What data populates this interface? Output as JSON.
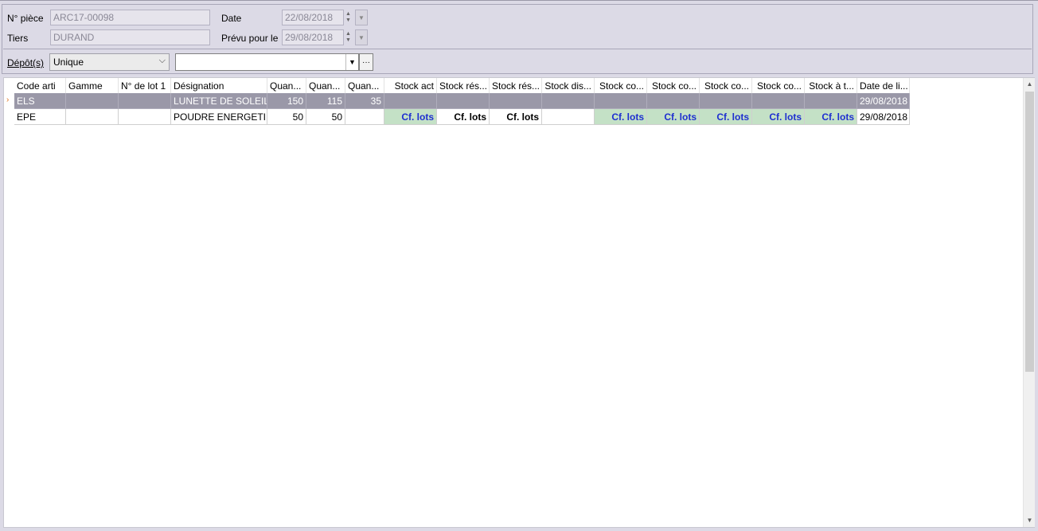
{
  "header": {
    "piece_label": "N° pièce",
    "piece_value": "ARC17-00098",
    "tiers_label": "Tiers",
    "tiers_value": "DURAND",
    "date_label": "Date",
    "date_value": "22/08/2018",
    "prevu_label": "Prévu pour le",
    "prevu_value": "29/08/2018",
    "depot_label": "Dépôt(s)",
    "depot_value": "Unique",
    "depot2_value": ""
  },
  "grid": {
    "columns": [
      "Code arti",
      "Gamme",
      "N° de lot 1",
      "Désignation",
      "Quan...",
      "Quan...",
      "Quan...",
      "Stock act",
      "Stock rés...",
      "Stock rés...",
      "Stock dis...",
      "Stock co...",
      "Stock co...",
      "Stock co...",
      "Stock co...",
      "Stock à t...",
      "Date de li..."
    ],
    "rows": [
      {
        "selected": true,
        "cells": [
          "ELS",
          "",
          "",
          "LUNETTE DE SOLEIL",
          "150",
          "115",
          "35",
          "",
          "",
          "",
          "",
          "",
          "",
          "",
          "",
          "",
          "29/08/2018"
        ]
      },
      {
        "selected": false,
        "cells": [
          "EPE",
          "",
          "",
          "POUDRE ENERGETI...",
          "50",
          "50",
          "",
          "Cf. lots",
          "Cf. lots",
          "Cf. lots",
          "",
          "Cf. lots",
          "Cf. lots",
          "Cf. lots",
          "Cf. lots",
          "Cf. lots",
          "29/08/2018"
        ]
      }
    ]
  },
  "icons": {
    "row_indicator": "current-row-icon",
    "spin": "spin-icon",
    "dropdown": "chevron-down-icon",
    "ellipsis": "ellipsis-icon"
  },
  "colors": {
    "selected_row": "#9a98a8",
    "lot_cell_bg": "#c4e1c6",
    "lot_text": "#1e2fd0",
    "row_indicator": "#e0701c"
  }
}
